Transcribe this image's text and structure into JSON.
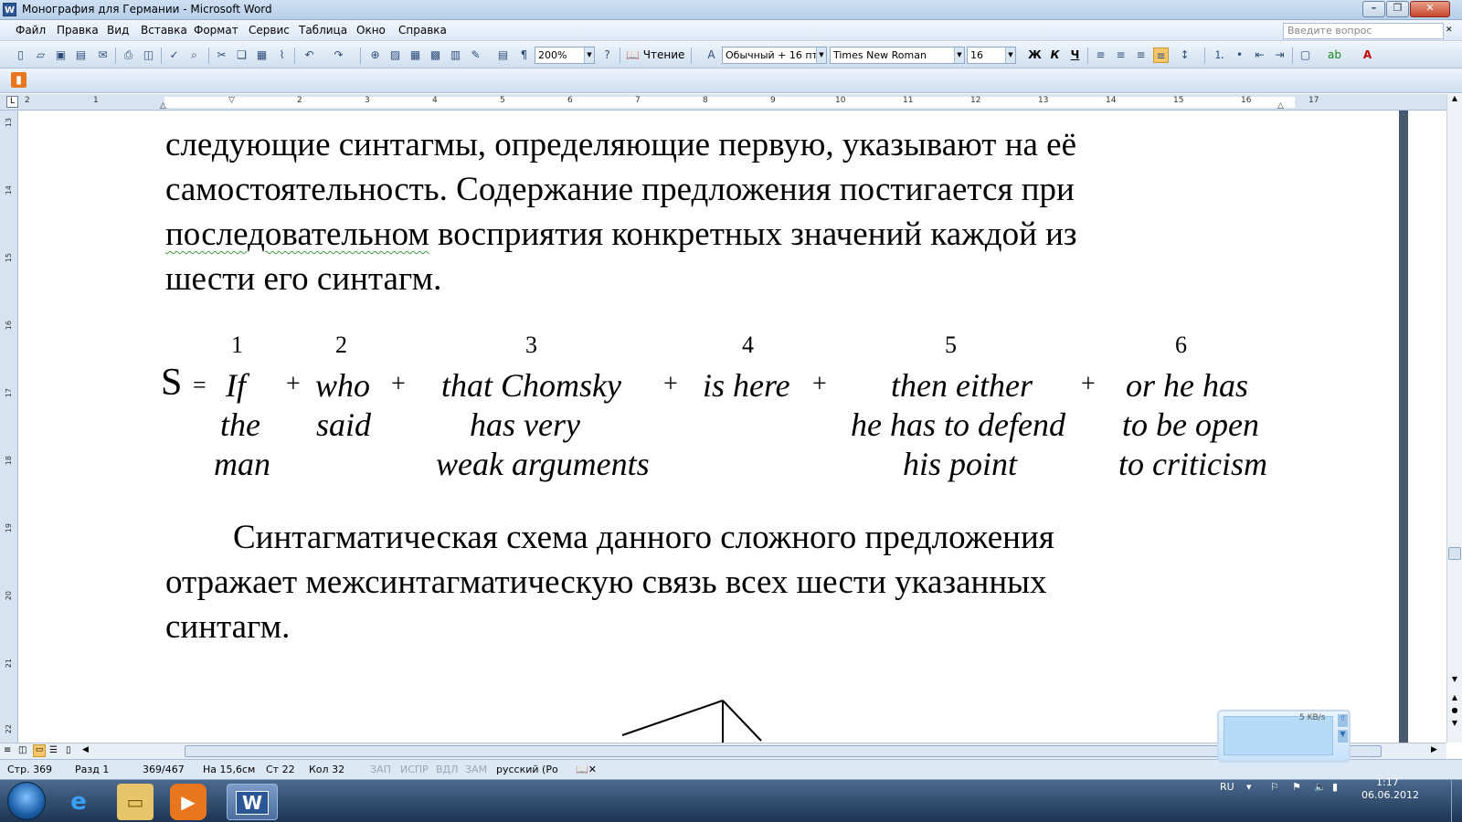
{
  "window": {
    "title": "Монография для Германии - Microsoft Word",
    "app_icon": "word-icon"
  },
  "menu": {
    "items": [
      "Файл",
      "Правка",
      "Вид",
      "Вставка",
      "Формат",
      "Сервис",
      "Таблица",
      "Окно",
      "Справка"
    ],
    "ask_placeholder": "Введите вопрос"
  },
  "toolbar": {
    "zoom": "200%",
    "reading_label": "Чтение",
    "style": "Обычный + 16 пт",
    "font": "Times New Roman",
    "size": "16",
    "bold": "Ж",
    "italic": "К",
    "underline": "Ч"
  },
  "ruler": {
    "h_numbers": [
      "2",
      "1",
      "1",
      "2",
      "3",
      "4",
      "5",
      "6",
      "7",
      "8",
      "9",
      "10",
      "11",
      "12",
      "13",
      "14",
      "15",
      "16",
      "17"
    ],
    "v_numbers": [
      "13",
      "14",
      "15",
      "16",
      "17",
      "18",
      "19",
      "20",
      "21",
      "22"
    ]
  },
  "document": {
    "para1_line0": "следующие синтагмы, определяющие первую, указывают на её",
    "para1_line1": "самостоятельность. Содержание предложения постигается при",
    "para1_line2_word": "последовательном",
    "para1_line2_rest": "восприятия конкретных значений каждой из",
    "para1_line3": "шести его синтагм.",
    "scheme": {
      "s_label": "S",
      "eq": "=",
      "plus": "+",
      "numbers": [
        "1",
        "2",
        "3",
        "4",
        "5",
        "6"
      ],
      "col1": [
        "If",
        "the",
        "man"
      ],
      "col2": [
        "who",
        "said"
      ],
      "col3": [
        "that Chomsky",
        "has very",
        "weak arguments"
      ],
      "col4": [
        "is here"
      ],
      "col5": [
        "then either",
        "he has to defend",
        "his point"
      ],
      "col6": [
        "or he has",
        "to be open",
        "to criticism"
      ]
    },
    "para2_line0": "Синтагматическая схема данного сложного предложения",
    "para2_line1": "отражает межсинтагматическую связь всех шести указанных",
    "para2_line2": "синтагм."
  },
  "status": {
    "page": "Стр. 369",
    "section": "Разд 1",
    "pages": "369/467",
    "at": "На 15,6см",
    "line": "Ст 22",
    "col": "Кол 32",
    "rec": "ЗАП",
    "trk": "ИСПР",
    "ext": "ВДЛ",
    "ovr": "ЗАМ",
    "lang": "русский (Ро"
  },
  "taskbar": {
    "lang": "RU",
    "time": "1:17",
    "date": "06.06.2012",
    "net_speed": "5 KB/s"
  }
}
